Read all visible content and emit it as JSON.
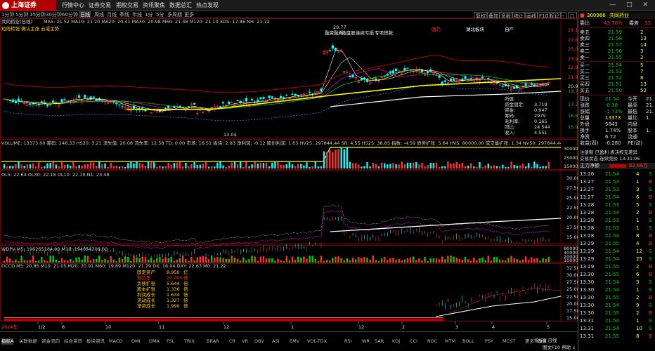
{
  "app": {
    "logo": "上海证券",
    "menus": [
      "行情中心",
      "证券交易",
      "期权交易",
      "资讯聚焦",
      "数据总汇",
      "热点发现"
    ],
    "win_controls": "— □ ✕"
  },
  "periods": {
    "items": [
      "1分钟",
      "5分钟",
      "15分钟",
      "30分钟",
      "60分钟",
      "日线",
      "周线",
      "月线",
      "季线",
      "年线",
      "1分",
      "5分",
      "多周期",
      "更多"
    ],
    "selected": "日线"
  },
  "tools": [
    "复权",
    "叠加",
    "多股",
    "统计",
    "画线",
    "F10",
    "标记",
    "-",
    "□"
  ],
  "main": {
    "header_left": "共同药业(日线)",
    "header_vals": "MA5: 21.52  MA10: 21.20  MA20: 20.41  MA30: 20.98  M60: 21.48  M120: 21.10  XDS: 17.86  NH: 21.72",
    "signal_line": "短线转强 确认主涨 云戒主势",
    "tags": [
      {
        "t": "融资融券",
        "c": "#fff"
      },
      {
        "t": "微盘股",
        "c": "#fff"
      },
      {
        "t": "连续亏损",
        "c": "#fff"
      },
      {
        "t": "专项贷款",
        "c": "#fff"
      },
      {
        "t": "国药",
        "c": "#ff3333"
      },
      {
        "t": "湖北板块",
        "c": "#fff"
      },
      {
        "t": "自产",
        "c": "#fff"
      }
    ],
    "high_label": "29.77",
    "low_label": "13.04",
    "yaxis": [
      "29.18",
      "27.60",
      "25.07",
      "23.90",
      "22.90",
      "21.92",
      "20.98",
      "19.73",
      "17.76",
      "16.69",
      "15.91"
    ],
    "info_box": [
      [
        "所属:",
        ""
      ],
      [
        "资金固定:",
        "3.719"
      ],
      [
        "资金:",
        "0.947"
      ],
      [
        "筹码:",
        "2979"
      ],
      [
        "毛利率:",
        "0.165"
      ],
      [
        "同比:",
        "24.544"
      ],
      [
        "收入:",
        "4.551"
      ]
    ]
  },
  "volume": {
    "header": "VOLUME: 13373.00  筹码: 246.33  HS20: 3.21  流失值: 20.08  流失率: 12.58  TD: 0.00  市场: 16.51  板块: 2.93  净利润: -0.12  股份利润: 1.63  HV25: 297844.44  SR: 4.55  HS25: 38.85  指数: -4.59  债务扩张: 5.64  HVS: 80000.00  成交量扩张: 1.34  NV50: 297844.44  FP: 164.08",
    "yaxis": [
      "30000",
      "25000",
      "15000"
    ]
  },
  "ind2": {
    "header": "OL5: 22.64  OL30: 22.18  OL10: 22.19  N1: 23.48",
    "yaxis": [
      "30.00",
      "27.50",
      "25.00",
      "22.50",
      "20.00",
      "17.50",
      "15.00"
    ]
  },
  "ind3": {
    "header": "WDPV  M5: 196265184.00  M10: 194054208.00",
    "yaxis": [
      "80000",
      "40000",
      "20000",
      "10000"
    ]
  },
  "ind4": {
    "header": "DCCD  M5: 20.85  M10: 21.05  M20: 20.91  M60: 19.89  M120: 21.79  DX: 16.04  DXY: 22.63  M0: 21.22",
    "yaxis": [
      "32.50",
      "30.00",
      "27.50",
      "25.00",
      "22.50",
      "20.00",
      "17.50",
      "15.00"
    ],
    "table": [
      [
        "固定资产",
        "8.950",
        "亿"
      ],
      [
        "现负率",
        "20.000",
        "倍"
      ],
      [
        "负债扩张",
        "5.644",
        "倍"
      ],
      [
        "股本扩张",
        "1.336",
        "倍"
      ],
      [
        "利润成长",
        "1.634",
        "倍"
      ],
      [
        "流动成长",
        "1.327",
        "倍"
      ],
      [
        "净资成长",
        "1.990",
        "倍"
      ]
    ]
  },
  "xaxis": [
    "2024年",
    "1/2",
    "8",
    "10",
    "11",
    "12",
    "1",
    "12",
    "2",
    "3",
    "4",
    "5"
  ],
  "bottom_tabs": [
    "指标A",
    "关联数据",
    "资金流向",
    "综合资讯",
    "板块资讯",
    "MACD",
    "DMI",
    "DMA",
    "FSL",
    "TRIX",
    "BRAR",
    "CR",
    "VR",
    "OBV",
    "ASI",
    "EMV",
    "VOL-TDX",
    "RSI",
    "WR",
    "SAR",
    "KDJ",
    "CCI",
    "ROC",
    "MTM",
    "BOLL",
    "PSY",
    "MCST",
    "更多",
    "设置"
  ],
  "bottom_right": "指标B  日线",
  "status_right": "图文F10  帮助 ↓",
  "quote": {
    "code": "300966",
    "name": "共同药业",
    "weibi_label": "委比",
    "weibi": "43.70%",
    "weicha_label": "委差",
    "weicha": "33",
    "asks": [
      [
        "卖五",
        "21.59",
        "2"
      ],
      [
        "卖四",
        "21.58",
        "13"
      ],
      [
        "卖三",
        "21.57",
        "14"
      ],
      [
        "卖二",
        "21.56",
        "3"
      ],
      [
        "卖一",
        "21.55",
        "2"
      ]
    ],
    "bids": [
      [
        "买一",
        "21.54",
        "5"
      ],
      [
        "买二",
        "21.53",
        "7"
      ],
      [
        "买三",
        "21.52",
        "8"
      ],
      [
        "买四",
        "21.51",
        "13"
      ],
      [
        "买五",
        "21.50",
        "52"
      ]
    ],
    "stats": [
      [
        "现价",
        "21.54",
        "今开",
        "21."
      ],
      [
        "涨跌",
        "-0.38",
        "最高",
        "21."
      ],
      [
        "涨幅",
        "-1.73%",
        "最低",
        "21."
      ],
      [
        "总量",
        "13373",
        "量比",
        "1."
      ],
      [
        "外盘",
        "5843",
        "内盘",
        ""
      ],
      [
        "换手",
        "1.74%",
        "股本",
        "1."
      ],
      [
        "净资",
        "6.72",
        "流通",
        ""
      ],
      [
        "收益(四)",
        "-0.280",
        "PE(动)",
        ""
      ]
    ],
    "notes": [
      "注册制 已盈利 表决权无差异",
      "交易状态:连续竞价 13:31:06"
    ],
    "zlje_label": "主力净额",
    "zlje": "82.66万",
    "ticks": [
      [
        "13:26",
        "21.54",
        "4",
        "S"
      ],
      [
        "13:27",
        "21.54",
        "1",
        "B"
      ],
      [
        "13:27",
        "21.53",
        "3",
        "S"
      ],
      [
        "13:27",
        "21.54",
        "6",
        "B"
      ],
      [
        "13:28",
        "21.53",
        "5",
        "S"
      ],
      [
        "13:28",
        "21.54",
        "2",
        "B"
      ],
      [
        "13:28",
        "21.53",
        "1",
        "S"
      ],
      [
        "13:28",
        "21.53",
        "1",
        "S"
      ],
      [
        "13:28",
        "21.54",
        "8",
        "B"
      ],
      [
        "13:29",
        "21.55",
        "4",
        "B"
      ],
      [
        "13:29",
        "21.54",
        "12",
        "S"
      ],
      [
        "13:29",
        "21.54",
        "25",
        "S"
      ],
      [
        "13:29",
        "21.55",
        "2",
        "B"
      ],
      [
        "13:30",
        "21.55",
        "6",
        "B"
      ],
      [
        "13:30",
        "21.54",
        "3",
        "S"
      ],
      [
        "13:30",
        "21.54",
        "1",
        "S"
      ],
      [
        "13:30",
        "21.55",
        "2",
        "B"
      ],
      [
        "13:30",
        "21.54",
        "9",
        "S"
      ],
      [
        "13:30",
        "21.55",
        "2",
        "B"
      ],
      [
        "13:31",
        "21.54",
        "1",
        "S"
      ],
      [
        "13:31",
        "21.54",
        "10",
        "S"
      ],
      [
        "13:31",
        "21.55",
        "8",
        "B"
      ]
    ]
  }
}
